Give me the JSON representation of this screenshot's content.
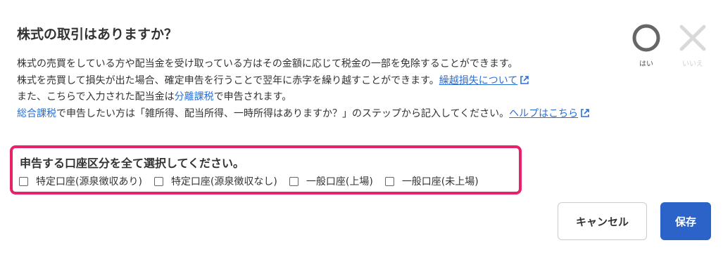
{
  "dialog": {
    "title": "株式の取引はありますか？",
    "description": {
      "line1": "株式の売買をしている方や配当金を受け取っている方はその金額に応じて税金の一部を免除することができます。",
      "line2_text": "株式を売買して損失が出た場合、確定申告を行うことで翌年に赤字を繰り越すことができます。",
      "line2_link": "繰越損失について",
      "line3_prefix": "また、こちらで入力された配当金は",
      "line3_term": "分離課税",
      "line3_suffix": "で申告されます。",
      "line4_term": "総合課税",
      "line4_text": "で申告したい方は「雑所得、配当所得、一時所得はありますか？」のステップから記入してください。",
      "line4_link": "ヘルプはこちら"
    },
    "answer": {
      "yes_label": "はい",
      "no_label": "いいえ",
      "yes_icon": "circle-icon",
      "no_icon": "cross-icon"
    },
    "account_section": {
      "title": "申告する口座区分を全て選択してください。",
      "options": [
        {
          "label": "特定口座(源泉徴収あり)",
          "checked": false
        },
        {
          "label": "特定口座(源泉徴収なし)",
          "checked": false
        },
        {
          "label": "一般口座(上場)",
          "checked": false
        },
        {
          "label": "一般口座(未上場)",
          "checked": false
        }
      ],
      "highlight_color": "#e8226a"
    },
    "buttons": {
      "cancel_label": "キャンセル",
      "save_label": "保存",
      "save_color": "#2b63c8"
    }
  }
}
